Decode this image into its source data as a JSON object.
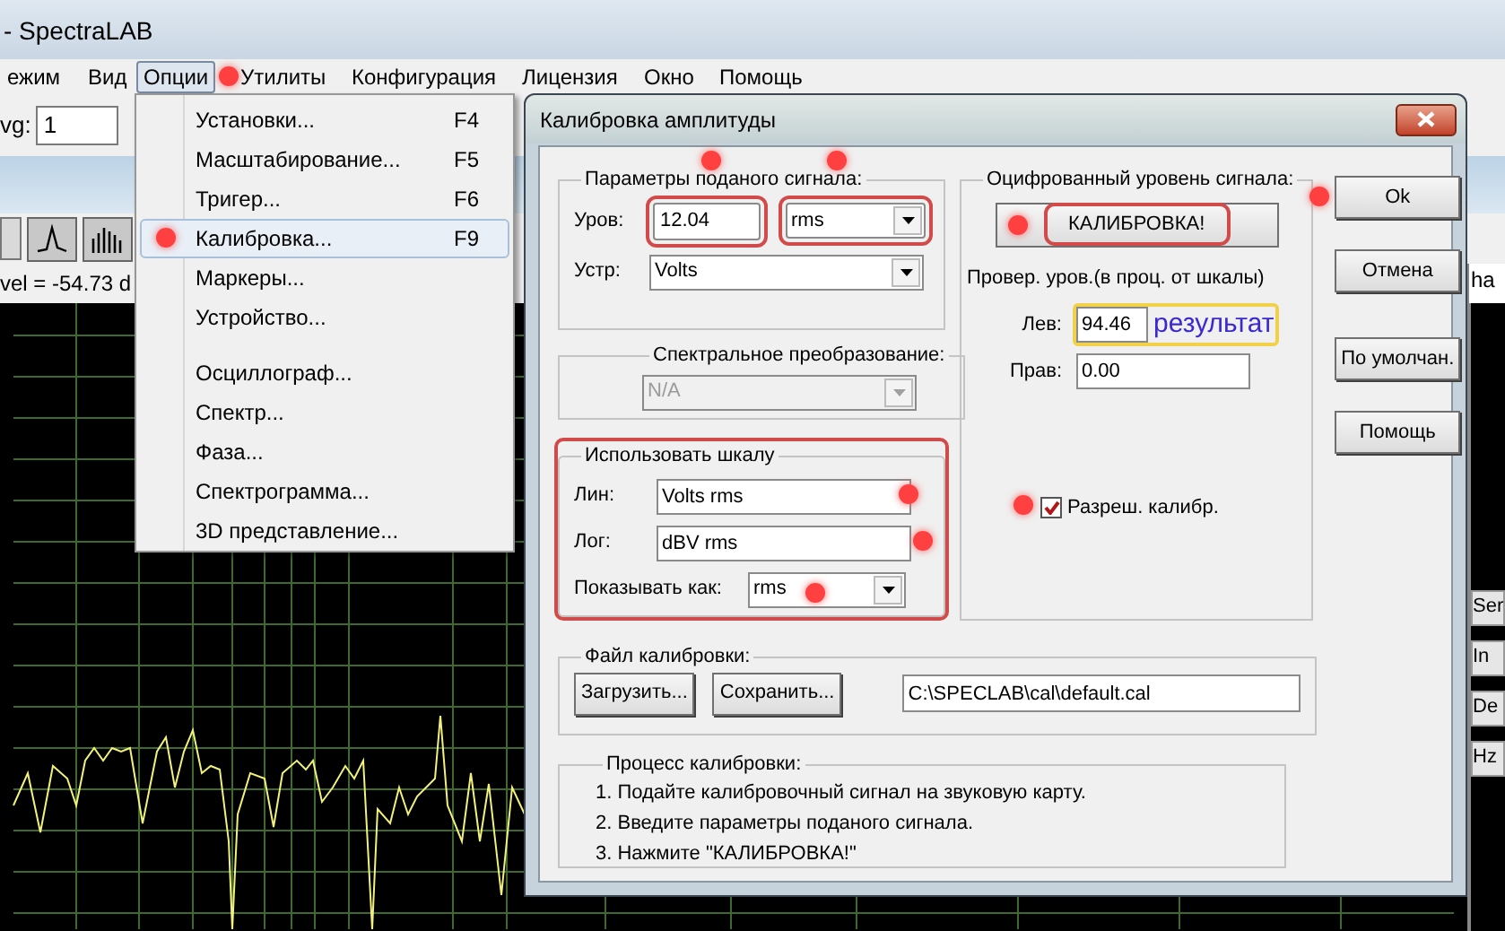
{
  "app": {
    "title": "- SpectraLAB"
  },
  "menu_bar": [
    {
      "label": "ежим",
      "selected": false
    },
    {
      "label": "Вид",
      "selected": false
    },
    {
      "label": "Опции",
      "selected": true,
      "dot": true
    },
    {
      "label": "Утилиты",
      "selected": false
    },
    {
      "label": "Конфигурация",
      "selected": false
    },
    {
      "label": "Лицензия",
      "selected": false
    },
    {
      "label": "Окно",
      "selected": false
    },
    {
      "label": "Помощь",
      "selected": false
    }
  ],
  "toolbar": {
    "avg_label": "vg:",
    "avg_value": "1",
    "tools": [
      {
        "kind": "peak"
      },
      {
        "kind": "bars"
      }
    ],
    "level_text": "vel = -54.73 d",
    "side_label": "ha"
  },
  "side_fragments": [
    "Ser",
    "In",
    "De",
    "Hz"
  ],
  "options_menu": [
    {
      "kind": "item",
      "label": "Установки...",
      "shortcut": "F4",
      "selected": false
    },
    {
      "kind": "item",
      "label": "Масштабирование...",
      "shortcut": "F5",
      "selected": false
    },
    {
      "kind": "item",
      "label": "Тригер...",
      "shortcut": "F6",
      "selected": false
    },
    {
      "kind": "item",
      "label": "Калибровка...",
      "shortcut": "F9",
      "selected": true,
      "dot": true
    },
    {
      "kind": "item",
      "label": "Маркеры...",
      "selected": false
    },
    {
      "kind": "item",
      "label": "Устройство...",
      "selected": false
    },
    {
      "kind": "separator"
    },
    {
      "kind": "item",
      "label": "Осциллограф...",
      "selected": false
    },
    {
      "kind": "item",
      "label": "Спектр...",
      "selected": false
    },
    {
      "kind": "item",
      "label": "Фаза...",
      "selected": false
    },
    {
      "kind": "item",
      "label": "Спектрограмма...",
      "selected": false
    },
    {
      "kind": "item",
      "label": "3D представление...",
      "selected": false
    }
  ],
  "dialog": {
    "title": "Калибровка амплитуды",
    "signal_group": {
      "legend": "Параметры поданого сигнала:",
      "dot": true,
      "level_label": "Уров:",
      "level_value": "12.04",
      "level_framed": true,
      "unit_value": "rms",
      "unit_framed": true,
      "device_label": "Устр:",
      "device_value": "Volts"
    },
    "spectral_group": {
      "legend": "Спектральное преобразование:",
      "value": "N/A",
      "disabled": true
    },
    "scale_group": {
      "legend": "Использовать шкалу",
      "framed": true,
      "lin_label": "Лин:",
      "lin_value": "Volts rms",
      "lin_dot": true,
      "log_label": "Лог:",
      "log_value": "dBV rms",
      "log_dot": true,
      "show_label": "Показывать как:",
      "show_value": "rms",
      "show_dot": true
    },
    "digitized_group": {
      "legend": "Оцифрованный уровень сигнала:",
      "calibrate_label": "КАЛИБРОВКА!",
      "calibrate_framed": true,
      "calibrate_dot": true,
      "check_caption": "Провер. уров.(в проц. от шкалы)",
      "left_label": "Лев:",
      "left_value": "94.46",
      "left_marked": true,
      "annotation": "результат",
      "right_label": "Прав:",
      "right_value": "0.00",
      "enable_label": "Разреш. калибр.",
      "enable_checked": true,
      "enable_dot": true
    },
    "buttons": [
      {
        "label": "Ok",
        "dot": true
      },
      {
        "label": "Отмена"
      },
      {
        "label": "По умолчан."
      },
      {
        "label": "Помощь"
      }
    ],
    "file_group": {
      "legend": "Файл калибровки:",
      "buttons": [
        "Загрузить...",
        "Сохранить..."
      ],
      "path": "C:\\SPECLAB\\cal\\default.cal"
    },
    "process_group": {
      "legend": "Процесс калибровки:",
      "steps": [
        "1. Подайте калибровочный сигнал на звуковую карту.",
        "2. Введите параметры поданого сигнала.",
        "3. Нажмите \"КАЛИБРОВКА!\""
      ]
    }
  }
}
